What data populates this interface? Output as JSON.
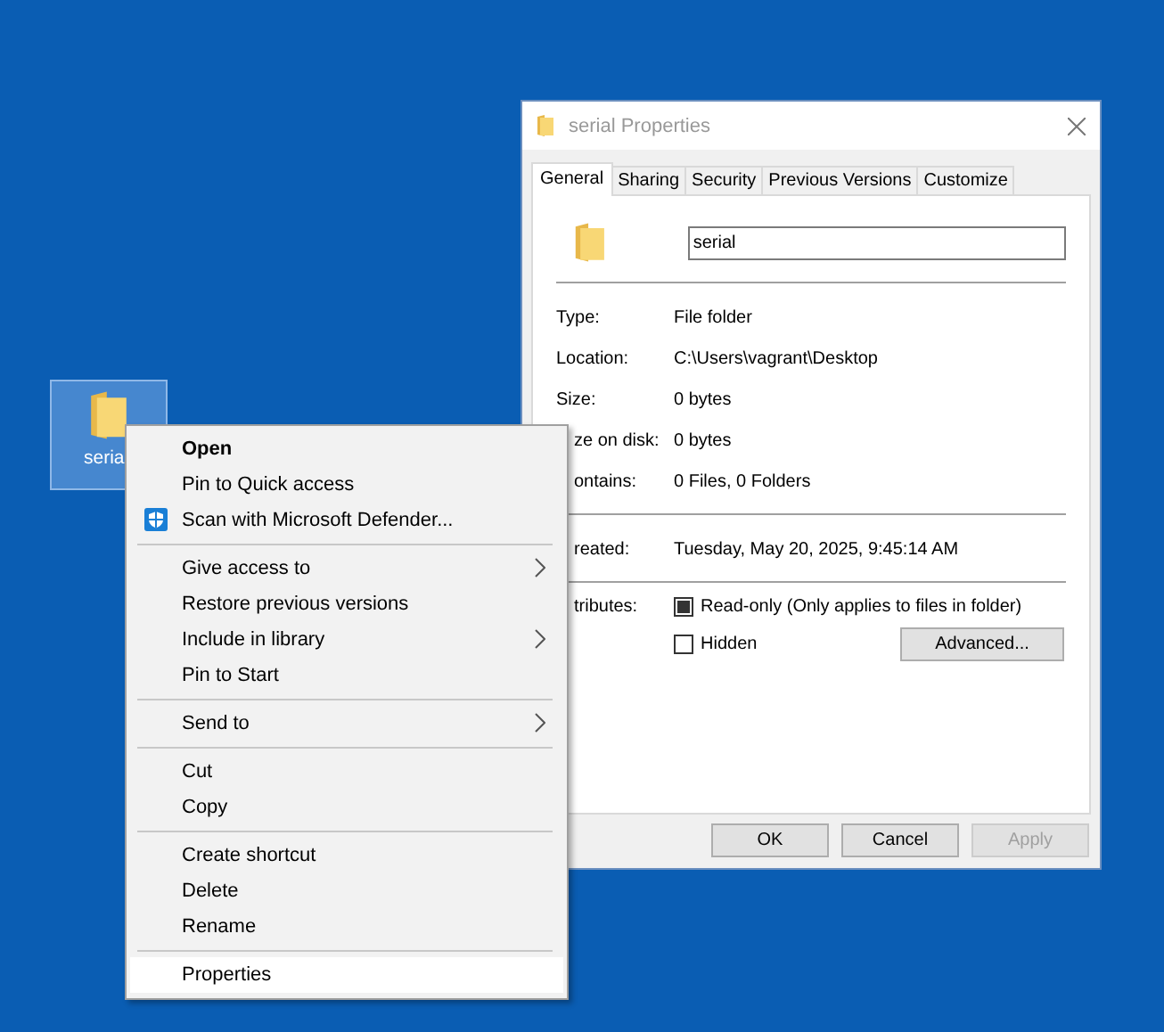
{
  "desktop_icon": {
    "label": "seria",
    "selected": true
  },
  "dialog": {
    "title": "serial Properties",
    "tabs": [
      {
        "label": "General",
        "selected": true
      },
      {
        "label": "Sharing",
        "selected": false
      },
      {
        "label": "Security",
        "selected": false
      },
      {
        "label": "Previous Versions",
        "selected": false
      },
      {
        "label": "Customize",
        "selected": false
      }
    ],
    "name_field": {
      "value": "serial"
    },
    "sections": [
      [
        {
          "label": "Type:",
          "value": "File folder",
          "clipped": false
        },
        {
          "label": "Location:",
          "value": "C:\\Users\\vagrant\\Desktop",
          "clipped": false
        },
        {
          "label": "Size:",
          "value": "0 bytes",
          "clipped": false
        },
        {
          "label": "ze on disk:",
          "value": "0 bytes",
          "clipped": true
        },
        {
          "label": "ontains:",
          "value": "0 Files, 0 Folders",
          "clipped": true
        }
      ],
      [
        {
          "label": "reated:",
          "value": "Tuesday, May 20, 2025, 9:45:14 AM",
          "clipped": true
        }
      ]
    ],
    "attributes": {
      "label": "tributes:",
      "clipped": true,
      "checkboxes": [
        {
          "label": "Read-only (Only applies to files in folder)",
          "checked": false,
          "indeterminate": true
        },
        {
          "label": "Hidden",
          "checked": false,
          "indeterminate": false
        }
      ],
      "advanced_button": "Advanced..."
    },
    "buttons": [
      {
        "label": "OK",
        "disabled": false
      },
      {
        "label": "Cancel",
        "disabled": false
      },
      {
        "label": "Apply",
        "disabled": true
      }
    ]
  },
  "context_menu": {
    "groups": [
      [
        {
          "label": "Open",
          "bold": true,
          "icon": false,
          "submenu": false,
          "selected": false
        },
        {
          "label": "Pin to Quick access",
          "bold": false,
          "icon": false,
          "submenu": false,
          "selected": false
        },
        {
          "label": "Scan with Microsoft Defender...",
          "bold": false,
          "icon": true,
          "submenu": false,
          "selected": false
        }
      ],
      [
        {
          "label": "Give access to",
          "bold": false,
          "icon": false,
          "submenu": true,
          "selected": false
        },
        {
          "label": "Restore previous versions",
          "bold": false,
          "icon": false,
          "submenu": false,
          "selected": false
        },
        {
          "label": "Include in library",
          "bold": false,
          "icon": false,
          "submenu": true,
          "selected": false
        },
        {
          "label": "Pin to Start",
          "bold": false,
          "icon": false,
          "submenu": false,
          "selected": false
        }
      ],
      [
        {
          "label": "Send to",
          "bold": false,
          "icon": false,
          "submenu": true,
          "selected": false
        }
      ],
      [
        {
          "label": "Cut",
          "bold": false,
          "icon": false,
          "submenu": false,
          "selected": false
        },
        {
          "label": "Copy",
          "bold": false,
          "icon": false,
          "submenu": false,
          "selected": false
        }
      ],
      [
        {
          "label": "Create shortcut",
          "bold": false,
          "icon": false,
          "submenu": false,
          "selected": false
        },
        {
          "label": "Delete",
          "bold": false,
          "icon": false,
          "submenu": false,
          "selected": false
        },
        {
          "label": "Rename",
          "bold": false,
          "icon": false,
          "submenu": false,
          "selected": false
        }
      ],
      [
        {
          "label": "Properties",
          "bold": false,
          "icon": false,
          "submenu": false,
          "selected": true
        }
      ]
    ]
  }
}
